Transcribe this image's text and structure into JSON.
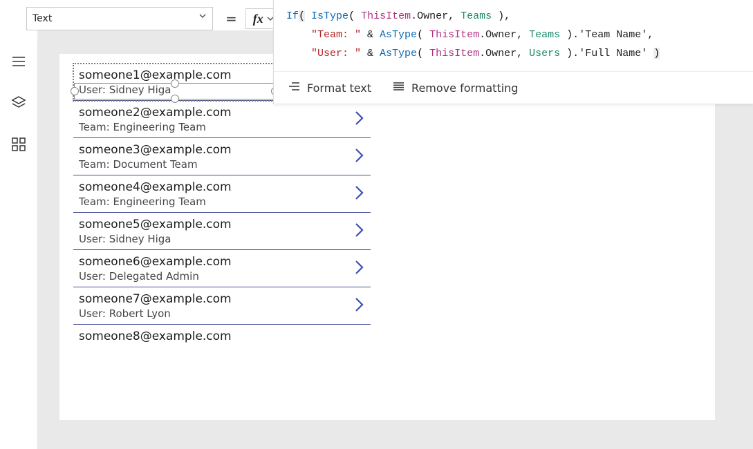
{
  "property_selector": {
    "value": "Text"
  },
  "formula": {
    "tokens": [
      {
        "row": 0,
        "kind": "func",
        "t": "If"
      },
      {
        "row": 0,
        "kind": "paren_hl",
        "t": "("
      },
      {
        "row": 0,
        "kind": "space",
        "t": " "
      },
      {
        "row": 0,
        "kind": "func",
        "t": "IsType"
      },
      {
        "row": 0,
        "kind": "paren",
        "t": "( "
      },
      {
        "row": 0,
        "kind": "prop",
        "t": "ThisItem"
      },
      {
        "row": 0,
        "kind": "dot",
        "t": "."
      },
      {
        "row": 0,
        "kind": "field",
        "t": "Owner"
      },
      {
        "row": 0,
        "kind": "comma",
        "t": ", "
      },
      {
        "row": 0,
        "kind": "type",
        "t": "Teams"
      },
      {
        "row": 0,
        "kind": "paren",
        "t": " )"
      },
      {
        "row": 0,
        "kind": "comma",
        "t": ","
      },
      {
        "row": 1,
        "kind": "indent",
        "t": "    "
      },
      {
        "row": 1,
        "kind": "str",
        "t": "\"Team: \""
      },
      {
        "row": 1,
        "kind": "amp",
        "t": " & "
      },
      {
        "row": 1,
        "kind": "func",
        "t": "AsType"
      },
      {
        "row": 1,
        "kind": "paren",
        "t": "( "
      },
      {
        "row": 1,
        "kind": "prop",
        "t": "ThisItem"
      },
      {
        "row": 1,
        "kind": "dot",
        "t": "."
      },
      {
        "row": 1,
        "kind": "field",
        "t": "Owner"
      },
      {
        "row": 1,
        "kind": "comma",
        "t": ", "
      },
      {
        "row": 1,
        "kind": "type",
        "t": "Teams"
      },
      {
        "row": 1,
        "kind": "paren",
        "t": " )"
      },
      {
        "row": 1,
        "kind": "dot",
        "t": "."
      },
      {
        "row": 1,
        "kind": "field",
        "t": "'Team Name'"
      },
      {
        "row": 1,
        "kind": "comma",
        "t": ","
      },
      {
        "row": 2,
        "kind": "indent",
        "t": "    "
      },
      {
        "row": 2,
        "kind": "str",
        "t": "\"User: \""
      },
      {
        "row": 2,
        "kind": "amp",
        "t": " & "
      },
      {
        "row": 2,
        "kind": "func",
        "t": "AsType"
      },
      {
        "row": 2,
        "kind": "paren",
        "t": "( "
      },
      {
        "row": 2,
        "kind": "prop",
        "t": "ThisItem"
      },
      {
        "row": 2,
        "kind": "dot",
        "t": "."
      },
      {
        "row": 2,
        "kind": "field",
        "t": "Owner"
      },
      {
        "row": 2,
        "kind": "comma",
        "t": ", "
      },
      {
        "row": 2,
        "kind": "type",
        "t": "Users"
      },
      {
        "row": 2,
        "kind": "paren",
        "t": " )"
      },
      {
        "row": 2,
        "kind": "dot",
        "t": "."
      },
      {
        "row": 2,
        "kind": "field",
        "t": "'Full Name'"
      },
      {
        "row": 2,
        "kind": "space",
        "t": " "
      },
      {
        "row": 2,
        "kind": "paren_hl",
        "t": ")"
      }
    ],
    "tools": {
      "format": "Format text",
      "remove": "Remove formatting"
    }
  },
  "gallery": {
    "items": [
      {
        "title": "someone1@example.com",
        "sub": "User: Sidney Higa",
        "selected": true
      },
      {
        "title": "someone2@example.com",
        "sub": "Team: Engineering Team",
        "selected": false
      },
      {
        "title": "someone3@example.com",
        "sub": "Team: Document Team",
        "selected": false
      },
      {
        "title": "someone4@example.com",
        "sub": "Team: Engineering Team",
        "selected": false
      },
      {
        "title": "someone5@example.com",
        "sub": "User: Sidney Higa",
        "selected": false
      },
      {
        "title": "someone6@example.com",
        "sub": "User: Delegated Admin",
        "selected": false
      },
      {
        "title": "someone7@example.com",
        "sub": "User: Robert Lyon",
        "selected": false
      },
      {
        "title": "someone8@example.com",
        "sub": "",
        "selected": false,
        "partial": true
      }
    ]
  }
}
